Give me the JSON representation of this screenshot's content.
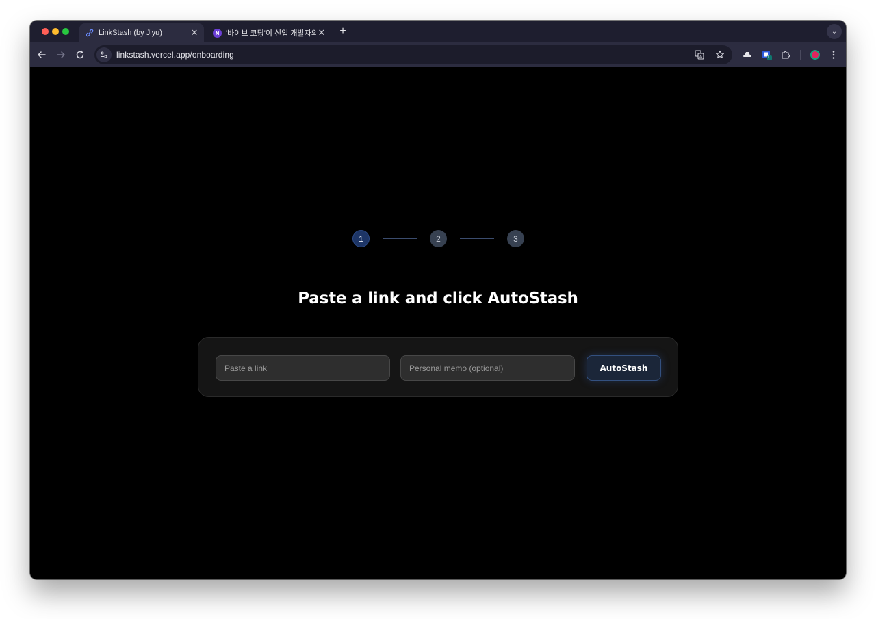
{
  "browser": {
    "tabs": [
      {
        "title": "LinkStash (by Jiyu)",
        "icon": "link-icon",
        "active": true,
        "close": "✕"
      },
      {
        "title": "'바이브 코딩'이 신입 개발자의 핵심",
        "icon": "site-logo-icon",
        "active": false,
        "close": "✕"
      }
    ],
    "new_tab": "+",
    "tab_menu": "⌄",
    "url_host": "linkstash.vercel.app",
    "url_path": "/onboarding",
    "extension_badge": "1",
    "colors": {
      "tabstrip": "#1e1e2f",
      "toolbar": "#2c2c40",
      "omnibox": "#1c1c2b"
    }
  },
  "onboarding": {
    "steps": [
      {
        "label": "1",
        "state": "active"
      },
      {
        "label": "2",
        "state": "pending"
      },
      {
        "label": "3",
        "state": "pending"
      }
    ],
    "heading": "Paste a link and click AutoStash",
    "link_placeholder": "Paste a link",
    "memo_placeholder": "Personal memo (optional)",
    "button_label": "AutoStash",
    "colors": {
      "background": "#000000",
      "card": "#151515",
      "step_active": "#1d3566",
      "step_pending": "#374151",
      "button": "#1b2639"
    }
  }
}
